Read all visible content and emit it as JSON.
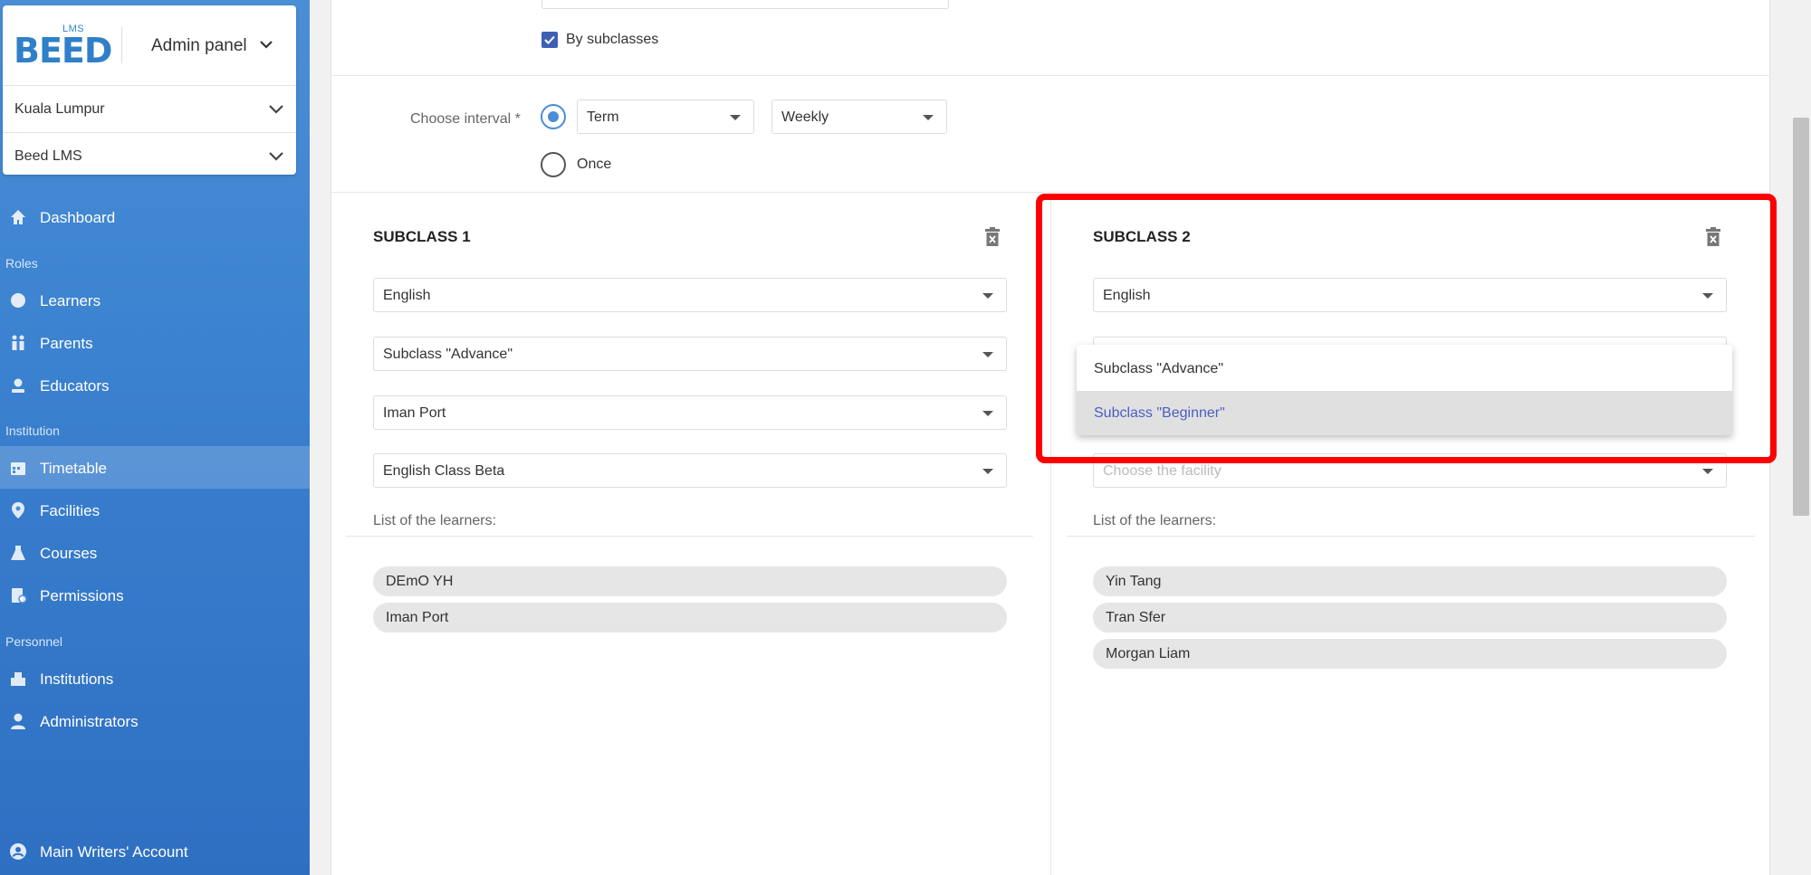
{
  "brand": {
    "logo_small": "LMS",
    "logo_text": "BEED",
    "panel_label": "Admin panel"
  },
  "selectors": {
    "city": "Kuala Lumpur",
    "institution": "Beed LMS"
  },
  "nav": {
    "dashboard": "Dashboard",
    "section_roles": "Roles",
    "learners": "Learners",
    "parents": "Parents",
    "educators": "Educators",
    "section_institution": "Institution",
    "timetable": "Timetable",
    "facilities": "Facilities",
    "courses": "Courses",
    "permissions": "Permissions",
    "section_personnel": "Personnel",
    "institutions": "Institutions",
    "administrators": "Administrators",
    "account": "Main Writers' Account"
  },
  "form": {
    "by_subclasses_label": "By subclasses",
    "by_subclasses_checked": true,
    "interval_label": "Choose interval *",
    "interval_term": "Term",
    "interval_frequency": "Weekly",
    "once_label": "Once",
    "selected_interval": "Term"
  },
  "subclass1": {
    "title": "SUBCLASS 1",
    "language": "English",
    "subclass": "Subclass \"Advance\"",
    "educator": "Iman Port",
    "facility": "English Class Beta",
    "learners_label": "List of the learners:",
    "learners": [
      "DEmO YH",
      "Iman Port"
    ]
  },
  "subclass2": {
    "title": "SUBCLASS 2",
    "language": "English",
    "facility_placeholder": "Choose the facility",
    "learners_label": "List of the learners:",
    "learners": [
      "Yin Tang",
      "Tran Sfer",
      "Morgan Liam"
    ]
  },
  "popup": {
    "options": [
      "Subclass \"Advance\"",
      "Subclass \"Beginner\""
    ],
    "hovered": "Subclass \"Beginner\""
  },
  "colors": {
    "sidebar": "#3b82d0",
    "accent": "#4a8ed6",
    "highlight": "#ff0000",
    "checkbox": "#3f5fb5"
  }
}
